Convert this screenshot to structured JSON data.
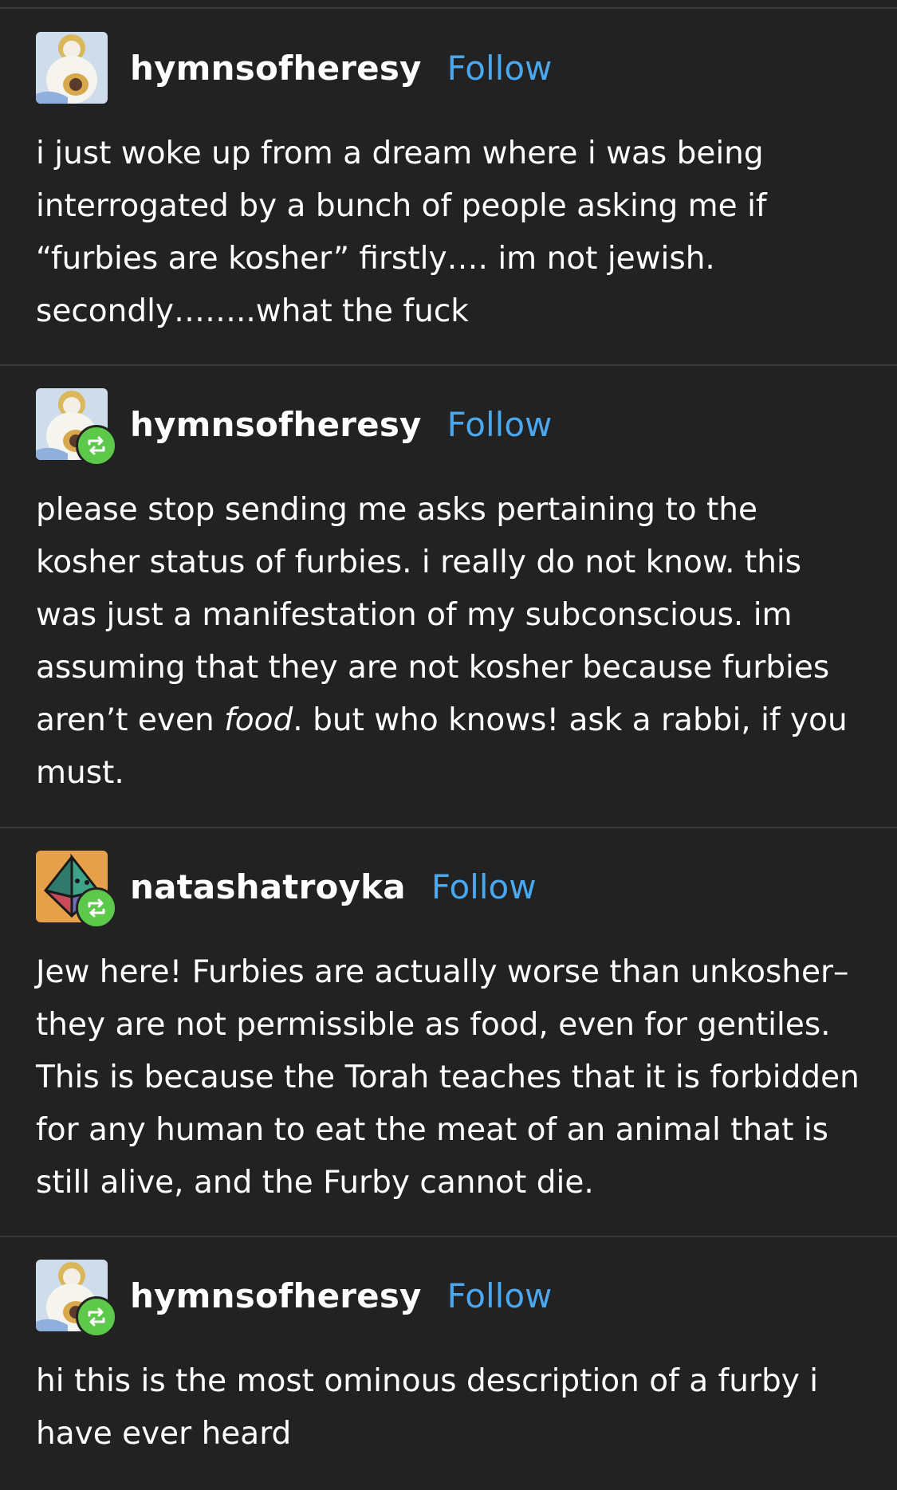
{
  "colors": {
    "background": "#222222",
    "divider": "#3a3a3a",
    "follow_link": "#4aa8f0",
    "reblog_badge": "#5cc94a",
    "text": "#ffffff"
  },
  "posts": [
    {
      "username": "hymnsofheresy",
      "follow_label": "Follow",
      "avatar_icon": "saint-icon-avatar",
      "reblogged": false,
      "body": "i just woke up from a dream where i was being interrogated by a bunch of people asking me if “furbies are kosher” firstly…. im not jewish. secondly……..what the fuck"
    },
    {
      "username": "hymnsofheresy",
      "follow_label": "Follow",
      "avatar_icon": "saint-icon-avatar",
      "reblogged": true,
      "body_before_em": "please stop sending me asks pertaining to the kosher status of furbies. i really do not know. this was just a manifestation of my subconscious. im assuming that they are not kosher because furbies aren’t even ",
      "body_em": "food",
      "body_after_em": ". but who knows! ask a rabbi, if you must."
    },
    {
      "username": "natashatroyka",
      "follow_label": "Follow",
      "avatar_icon": "d4-die-avatar",
      "reblogged": true,
      "body": "Jew here! Furbies are actually worse than unkosher–they are not permissible as food, even for gentiles. This is because the Torah teaches that it is forbidden for any human to eat the meat of an animal that is still alive, and the Furby cannot die."
    },
    {
      "username": "hymnsofheresy",
      "follow_label": "Follow",
      "avatar_icon": "saint-icon-avatar",
      "reblogged": true,
      "body": "hi this is the most ominous description of a furby i have ever heard"
    }
  ]
}
